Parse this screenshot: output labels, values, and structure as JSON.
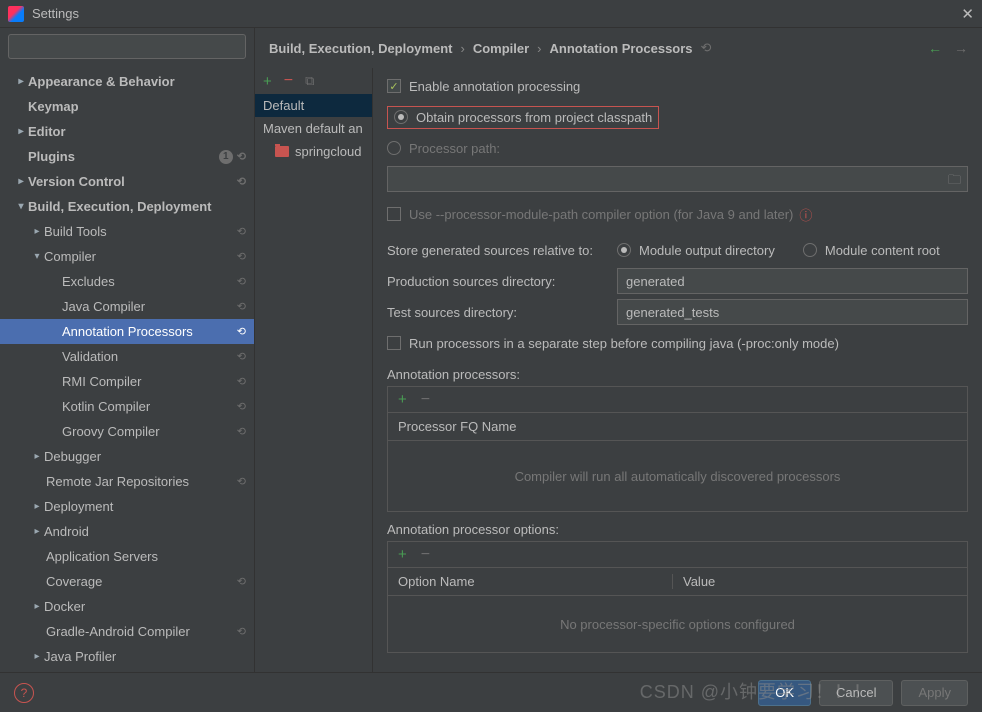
{
  "window": {
    "title": "Settings"
  },
  "search": {
    "placeholder": ""
  },
  "tree": {
    "appearance": "Appearance & Behavior",
    "keymap": "Keymap",
    "editor": "Editor",
    "plugins": "Plugins",
    "plugins_badge": "1",
    "version_control": "Version Control",
    "bed": "Build, Execution, Deployment",
    "build_tools": "Build Tools",
    "compiler": "Compiler",
    "excludes": "Excludes",
    "java_compiler": "Java Compiler",
    "annotation_processors": "Annotation Processors",
    "validation": "Validation",
    "rmi": "RMI Compiler",
    "kotlin": "Kotlin Compiler",
    "groovy": "Groovy Compiler",
    "debugger": "Debugger",
    "remote_jar": "Remote Jar Repositories",
    "deployment": "Deployment",
    "android": "Android",
    "app_servers": "Application Servers",
    "coverage": "Coverage",
    "docker": "Docker",
    "gradle_android": "Gradle-Android Compiler",
    "java_profiler": "Java Profiler"
  },
  "breadcrumb": {
    "p1": "Build, Execution, Deployment",
    "p2": "Compiler",
    "p3": "Annotation Processors"
  },
  "profiles": {
    "default": "Default",
    "maven": "Maven default an",
    "module": "springcloud"
  },
  "form": {
    "enable": "Enable annotation processing",
    "obtain": "Obtain processors from project classpath",
    "proc_path": "Processor path:",
    "use_module_path": "Use --processor-module-path compiler option (for Java 9 and later)",
    "store_label": "Store generated sources relative to:",
    "module_output": "Module output directory",
    "module_content": "Module content root",
    "prod_dir_label": "Production sources directory:",
    "prod_dir_val": "generated",
    "test_dir_label": "Test sources directory:",
    "test_dir_val": "generated_tests",
    "run_separate": "Run processors in a separate step before compiling java (-proc:only mode)",
    "ann_proc_label": "Annotation processors:",
    "fq_name": "Processor FQ Name",
    "auto_discover": "Compiler will run all automatically discovered processors",
    "ann_opt_label": "Annotation processor options:",
    "opt_name": "Option Name",
    "opt_value": "Value",
    "no_opts": "No processor-specific options configured"
  },
  "buttons": {
    "ok": "OK",
    "cancel": "Cancel",
    "apply": "Apply"
  },
  "watermark": "CSDN @小钟要学习！！！"
}
